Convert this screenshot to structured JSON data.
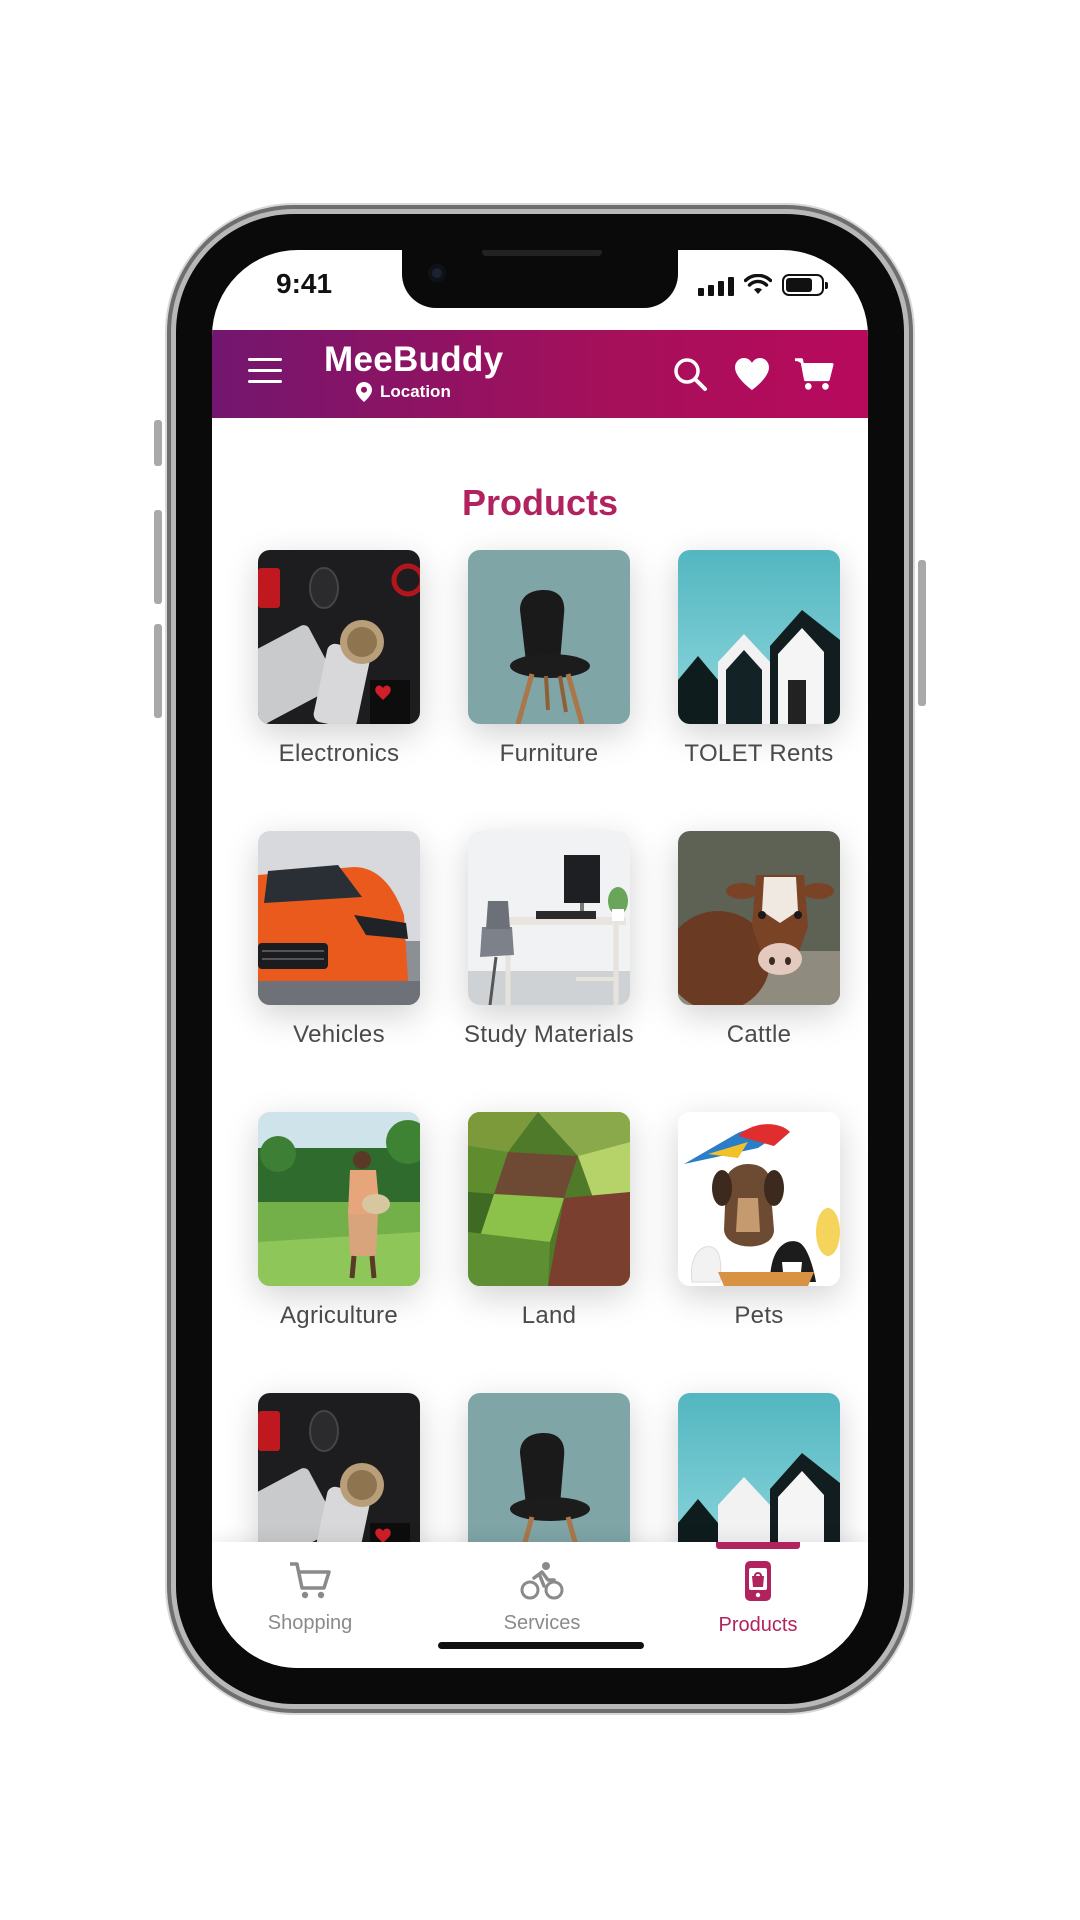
{
  "status_bar": {
    "time": "9:41"
  },
  "header": {
    "app_name": "MeeBuddy",
    "location_label": "Location",
    "icons": [
      "menu-icon",
      "location-pin-icon",
      "search-icon",
      "heart-icon",
      "cart-icon"
    ],
    "gradient_start": "#73166f",
    "gradient_end": "#b80a5c"
  },
  "page": {
    "title": "Products",
    "accent_color": "#b1235e"
  },
  "categories": [
    {
      "label": "Electronics"
    },
    {
      "label": "Furniture"
    },
    {
      "label": "TOLET Rents"
    },
    {
      "label": "Vehicles"
    },
    {
      "label": "Study Materials"
    },
    {
      "label": "Cattle"
    },
    {
      "label": "Agriculture"
    },
    {
      "label": "Land"
    },
    {
      "label": "Pets"
    },
    {
      "label": ""
    },
    {
      "label": ""
    },
    {
      "label": ""
    }
  ],
  "bottom_nav": {
    "items": [
      {
        "label": "Shopping",
        "icon": "cart-icon",
        "active": false
      },
      {
        "label": "Services",
        "icon": "cyclist-icon",
        "active": false
      },
      {
        "label": "Products",
        "icon": "mobile-bag-icon",
        "active": true
      }
    ],
    "active_color": "#b1235e",
    "inactive_color": "#8a8a8a"
  }
}
